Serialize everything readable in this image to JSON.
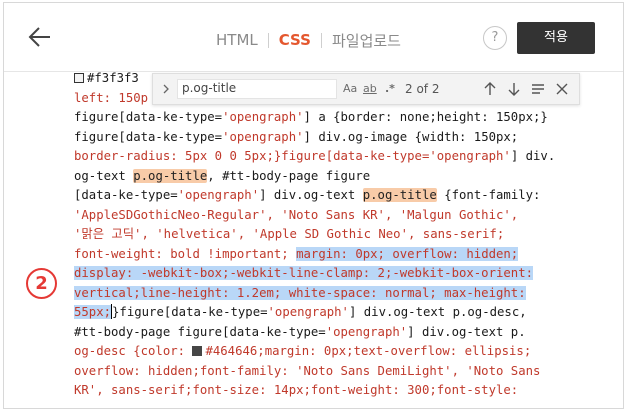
{
  "header": {
    "tabs": [
      "HTML",
      "CSS",
      "파일업로드"
    ],
    "active_tab": "CSS",
    "help_label": "?",
    "apply_label": "적용"
  },
  "find": {
    "query": "p.og-title",
    "case_label": "Aa",
    "word_label": "ab",
    "regex_label": ".*",
    "count": "2 of 2"
  },
  "marker": "2",
  "colors": {
    "swatch_1": "#f3f3f3",
    "swatch_2": "#464646",
    "accent": "#e4572e",
    "selection": "#b9d7f7",
    "match": "#f8cba8"
  },
  "code": {
    "l1": "#f3f3f3",
    "l2": "left: 150p",
    "l3_a": "figure[data-ke-type=",
    "l3_b": "'opengraph'",
    "l3_c": "] a {border: none;height: 150px;}",
    "l4_a": "figure[data-ke-type=",
    "l4_b": "'opengraph'",
    "l4_c": "] div.og-image {width: 150px;",
    "l5_a": "border-radius: 5px 0 0 5px;}figure[data-ke-type=",
    "l5_b": "'opengraph'",
    "l5_c": "] div.",
    "l6_a": "og-text ",
    "l6_b": "p.og-title",
    "l6_c": ", #tt-body-page figure",
    "l7_a": "[data-ke-type=",
    "l7_b": "'opengraph'",
    "l7_c": "] div.og-text ",
    "l7_d": "p.og-title",
    "l7_e": " {font-family:",
    "l8": "'AppleSDGothicNeo-Regular', 'Noto Sans KR', 'Malgun Gothic',",
    "l9": "'맑은 고딕', 'helvetica', 'Apple SD Gothic Neo', sans-serif;",
    "l10_a": "font-weight: bold !important; ",
    "l10_b": "margin: 0px; overflow: hidden;",
    "l11": "display: -webkit-box;-webkit-line-clamp: 2;-webkit-box-orient:",
    "l12": "vertical;line-height: 1.2em; white-space: normal; max-height:",
    "l13_a": "55px;",
    "l13_b": "}figure[data-ke-type=",
    "l13_c": "'opengraph'",
    "l13_d": "] div.og-text p.og-desc,",
    "l14_a": "#tt-body-page figure[data-ke-type=",
    "l14_b": "'opengraph'",
    "l14_c": "] div.og-text p.",
    "l15": "og-desc {color: ",
    "l15_b": "#464646;margin: 0px;text-overflow: ellipsis;",
    "l16": "overflow: hidden;font-family: 'Noto Sans DemiLight', 'Noto Sans",
    "l17": "KR', sans-serif;font-size: 14px;font-weight: 300;font-style:"
  }
}
